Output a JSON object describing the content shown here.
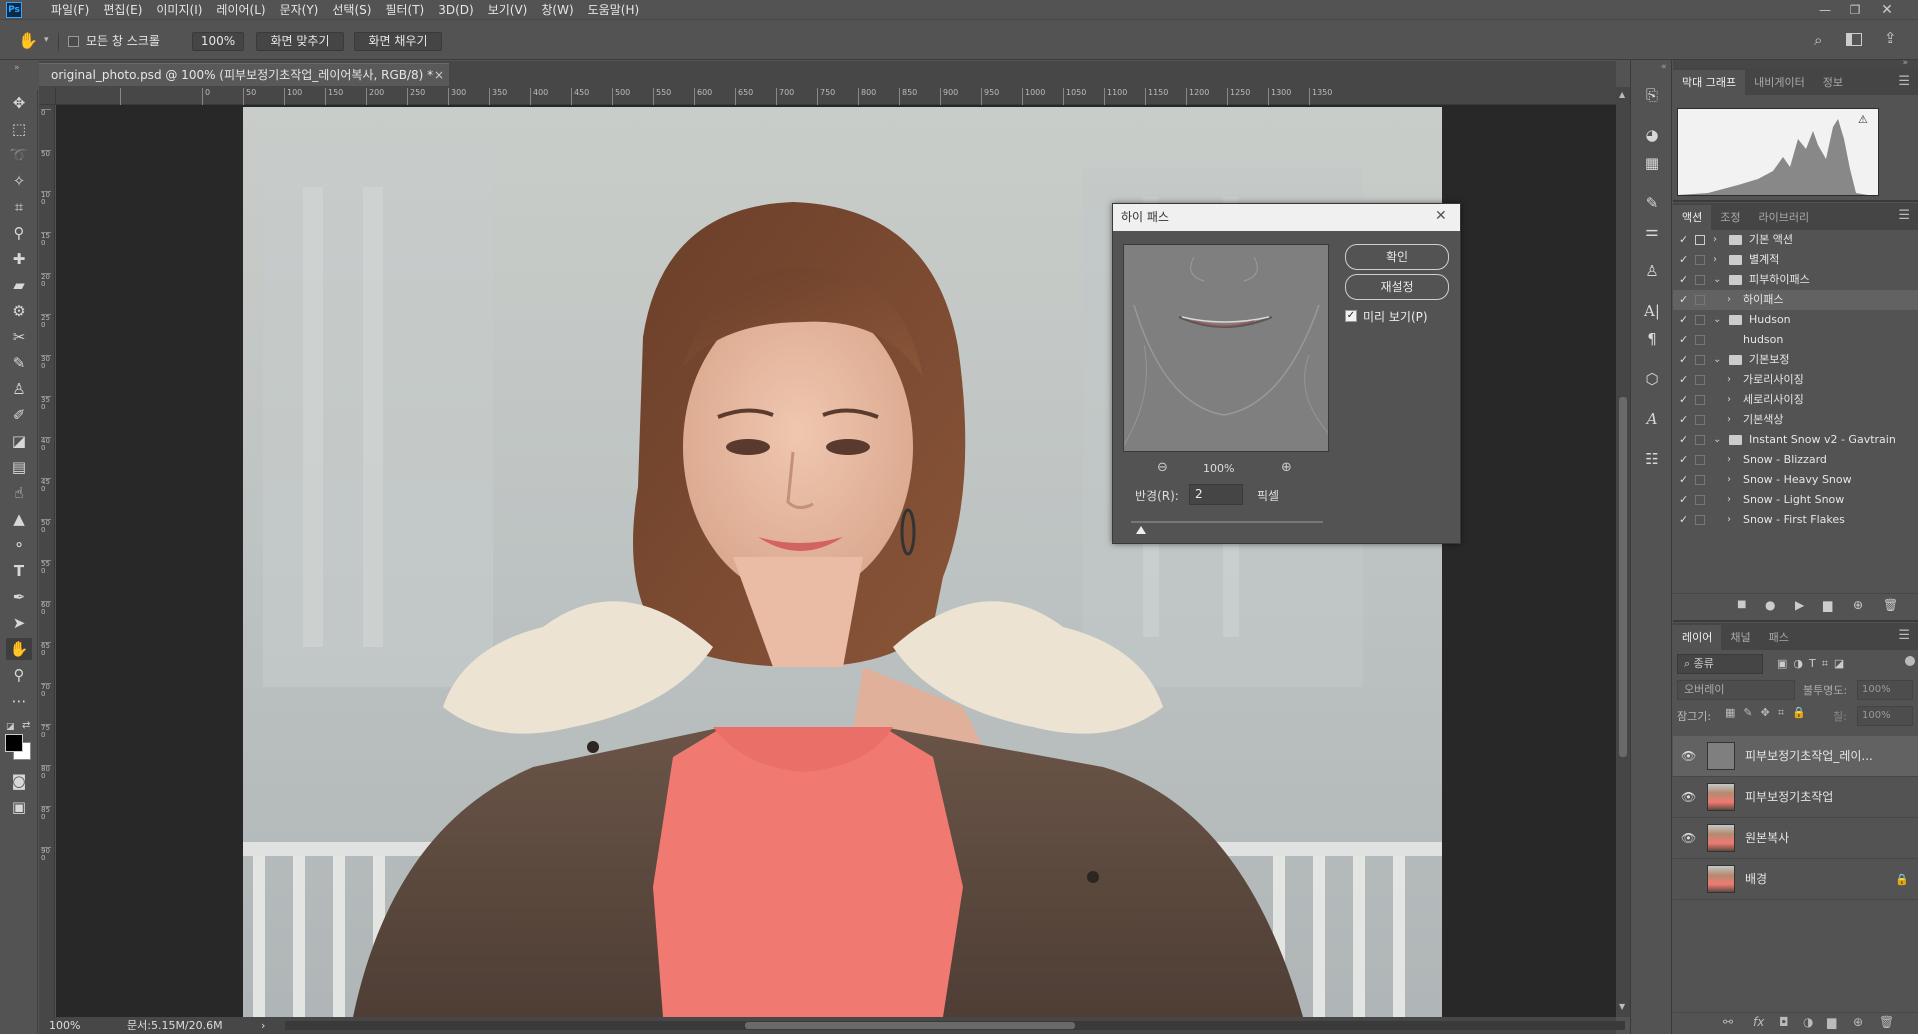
{
  "app": {
    "logo": "Ps"
  },
  "menu": [
    "파일(F)",
    "편집(E)",
    "이미지(I)",
    "레이어(L)",
    "문자(Y)",
    "선택(S)",
    "필터(T)",
    "3D(D)",
    "보기(V)",
    "창(W)",
    "도움말(H)"
  ],
  "options": {
    "scroll_all_label": "모든 창 스크롤",
    "zoom_value": "100%",
    "fit_screen": "화면 맞추기",
    "fill_screen": "화면 채우기"
  },
  "document": {
    "tab_title": "original_photo.psd @ 100% (피부보정기초작업_레이어복사, RGB/8) *",
    "tab_close": "×",
    "ruler_ticks": [
      "0",
      "50",
      "100",
      "150",
      "200",
      "250",
      "300",
      "350",
      "400",
      "450",
      "500",
      "550",
      "600",
      "650",
      "700",
      "750",
      "800",
      "850",
      "900",
      "950",
      "1000",
      "1050",
      "1100",
      "1150",
      "1200",
      "1250",
      "1300",
      "1350"
    ],
    "ruler_v_ticks": [
      "0",
      "50",
      "100",
      "150",
      "200",
      "250",
      "300",
      "350",
      "400",
      "450",
      "500",
      "550",
      "600",
      "650",
      "700",
      "750",
      "800",
      "850",
      "900"
    ]
  },
  "status": {
    "zoom": "100%",
    "doc_size": "문서:5.15M/20.6M",
    "arrow": "›"
  },
  "panels": {
    "top_tabs": [
      "막대 그래프",
      "내비게이터",
      "정보"
    ],
    "actions_tabs": [
      "액션",
      "조정",
      "라이브러리"
    ],
    "actions": [
      {
        "indent": 0,
        "type": "folder",
        "label": "기본 액션",
        "modal": true,
        "open": false
      },
      {
        "indent": 0,
        "type": "folder",
        "label": "별계적",
        "modal": false,
        "open": false
      },
      {
        "indent": 0,
        "type": "folder",
        "label": "피부하이패스",
        "modal": false,
        "open": true
      },
      {
        "indent": 1,
        "type": "action",
        "label": "하이패스",
        "modal": false,
        "open": false,
        "selected": true
      },
      {
        "indent": 0,
        "type": "folder",
        "label": "Hudson",
        "modal": false,
        "open": true
      },
      {
        "indent": 1,
        "type": "action-noarrow",
        "label": "hudson",
        "modal": false,
        "open": false
      },
      {
        "indent": 0,
        "type": "folder",
        "label": "기본보정",
        "modal": false,
        "open": true
      },
      {
        "indent": 1,
        "type": "action",
        "label": "가로리사이징",
        "modal": false,
        "open": false
      },
      {
        "indent": 1,
        "type": "action",
        "label": "세로리사이징",
        "modal": false,
        "open": false
      },
      {
        "indent": 1,
        "type": "action",
        "label": "기본색상",
        "modal": false,
        "open": false
      },
      {
        "indent": 0,
        "type": "folder",
        "label": "Instant Snow v2 - Gavtrain",
        "modal": false,
        "open": true
      },
      {
        "indent": 1,
        "type": "action",
        "label": "Snow - Blizzard",
        "modal": false,
        "open": false
      },
      {
        "indent": 1,
        "type": "action",
        "label": "Snow - Heavy Snow",
        "modal": false,
        "open": false
      },
      {
        "indent": 1,
        "type": "action",
        "label": "Snow - Light Snow",
        "modal": false,
        "open": false
      },
      {
        "indent": 1,
        "type": "action",
        "label": "Snow - First Flakes",
        "modal": false,
        "open": false
      }
    ],
    "layers_tabs": [
      "레이어",
      "채널",
      "패스"
    ],
    "layer_filter": "종류",
    "blend_mode": "오버레이",
    "opacity_label": "불투명도:",
    "opacity_value": "100%",
    "lock_label": "잠그기:",
    "fill_label": "칠:",
    "fill_value": "100%",
    "layers": [
      {
        "name": "피부보정기초작업_레이...",
        "visible": true,
        "thumb": "gray",
        "selected": true,
        "locked": false
      },
      {
        "name": "피부보정기초작업",
        "visible": true,
        "thumb": "photo",
        "selected": false,
        "locked": false
      },
      {
        "name": "원본복사",
        "visible": true,
        "thumb": "photo",
        "selected": false,
        "locked": false
      },
      {
        "name": "배경",
        "visible": false,
        "thumb": "photo",
        "selected": false,
        "locked": true
      }
    ]
  },
  "dialog": {
    "title": "하이 패스",
    "ok": "확인",
    "reset": "재설정",
    "preview_label": "미리 보기(P)",
    "preview_checked": true,
    "zoom": "100%",
    "radius_label": "반경(R):",
    "radius_value": "2",
    "radius_unit": "픽셀",
    "radius_fraction": 0.02
  },
  "colors": {
    "accent": "#31a8ff",
    "panel": "#535353",
    "canvas_bg": "#282828",
    "sweater": "#f07a72"
  }
}
